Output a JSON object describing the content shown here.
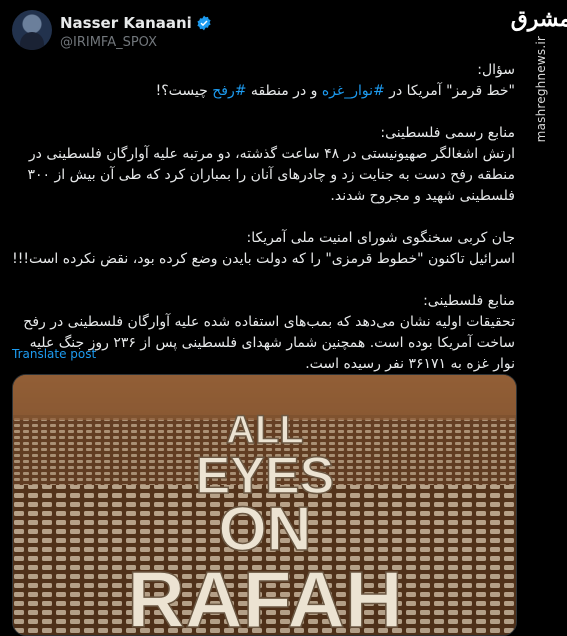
{
  "author": {
    "name": "Nasser Kanaani",
    "handle": "@IRIMFA_SPOX",
    "verified_icon": "verified-badge-icon"
  },
  "watermark": {
    "logo": "مشرق",
    "url": "mashreghnews.ir"
  },
  "tweet": {
    "question_label": "سؤال:",
    "question_part1": "\"خط قرمز\" آمریکا در ",
    "hashtag1": "#نوار_غزه",
    "question_part2": " و در منطقه ",
    "hashtag2": "#رفح",
    "question_part3": " چیست؟!",
    "source1_label": "منابع رسمی فلسطینی:",
    "source1_text": "ارتش اشغالگر صهیونیستی در ۴۸ ساعت گذشته، دو مرتبه علیه آوارگان فلسطینی در منطقه رفح دست به جنایت زد و چادرهای آنان را بمباران کرد که طی آن بیش از ۳۰۰ فلسطینی شهید و مجروح شدند.",
    "source2_label": "جان کربی سخنگوی شورای امنیت ملی آمریکا:",
    "source2_text": "اسرائیل تاکنون \"خطوط قرمزی\" را که دولت بایدن وضع کرده بود، نقض نکرده است!!!",
    "source3_label": "منابع فلسطینی:",
    "source3_text": "تحقیقات اولیه نشان می‌دهد که بمب‌های استفاده شده علیه آوارگان فلسطینی در رفح ساخت آمریکا بوده است. همچنین شمار شهدای فلسطینی پس از ۲۳۶ روز جنگ علیه نوار غزه به ۳۶۱۷۱ نفر رسیده است."
  },
  "translate_label": "Translate post",
  "media": {
    "line1": "ALL",
    "line2": "EYES",
    "line3": "ON",
    "line4": "RAFAH",
    "colors": {
      "ground": "#6b4325",
      "tents": "#d9cdb8",
      "sky": "#8a5a34"
    }
  }
}
